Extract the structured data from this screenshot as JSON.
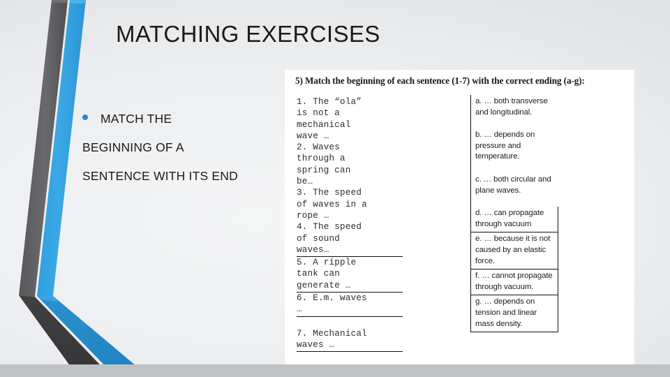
{
  "slide": {
    "title": "MATCHING EXERCISES",
    "theme_accent": "#2489c8",
    "theme_dark": "#4a4a4a",
    "background": "#e8eaec",
    "bottom_band_color": "#bfc1c2"
  },
  "body": {
    "bullet_lines": [
      "MATCH THE",
      "BEGINNING OF A",
      "SENTENCE WITH ITS END"
    ]
  },
  "document": {
    "instruction": "5) Match the beginning of each sentence (1-7) with the correct ending (a-g):",
    "stems": [
      {
        "text": "1. The “ola”\nis not a\nmechanical\nwave …",
        "ruled": false
      },
      {
        "text": "2. Waves\nthrough a\nspring can\nbe…",
        "ruled": false
      },
      {
        "text": "3. The speed\nof waves in a\nrope …",
        "ruled": false
      },
      {
        "text": "4. The speed\nof sound\nwaves…",
        "ruled": true
      },
      {
        "text": "5. A ripple\ntank can\ngenerate …",
        "ruled": true
      },
      {
        "text": "6. E.m. waves\n…",
        "ruled": true
      },
      {
        "text": "7. Mechanical\nwaves …",
        "ruled": true
      }
    ],
    "endings": [
      {
        "text": "a. … both transverse and longitudinal.",
        "boxed": false
      },
      {
        "text": "b. … depends on pressure and temperature.",
        "boxed": false
      },
      {
        "text": "c. … both circular and plane waves.",
        "boxed": false
      },
      {
        "text": "d. … can propagate through vacuum",
        "boxed": true
      },
      {
        "text": "e. … because it is not caused by an elastic force.",
        "boxed": true
      },
      {
        "text": "f. … cannot propagate through vacuum.",
        "boxed": true
      },
      {
        "text": "g. … depends on tension and linear mass density.",
        "boxed": true
      }
    ]
  }
}
